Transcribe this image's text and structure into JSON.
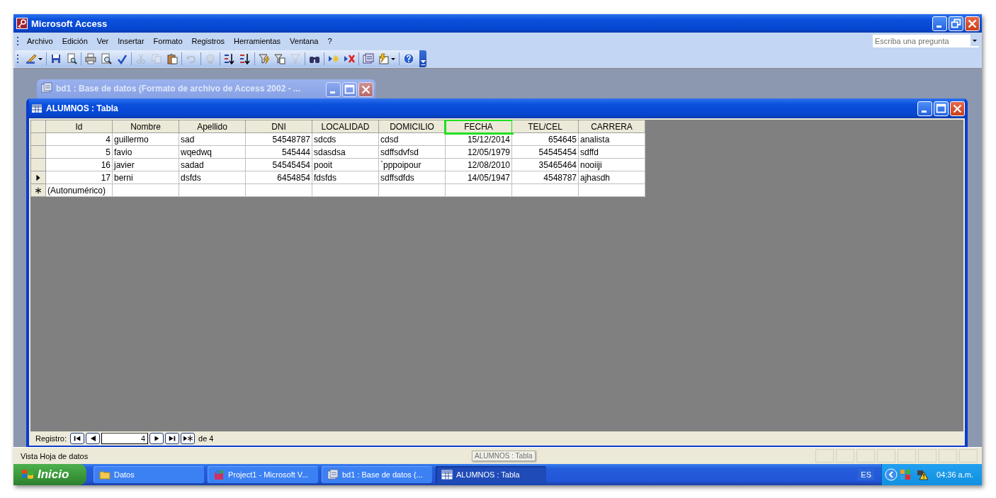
{
  "window": {
    "title": "Microsoft Access"
  },
  "menu": [
    "Archivo",
    "Edición",
    "Ver",
    "Insertar",
    "Formato",
    "Registros",
    "Herramientas",
    "Ventana",
    "?"
  ],
  "question_box": {
    "placeholder": "Escriba una pregunta"
  },
  "toolbar": [
    [
      {
        "kind": "design",
        "disabled": false,
        "dropdown": true
      }
    ],
    [
      {
        "kind": "save",
        "disabled": false
      },
      {
        "kind": "file-search",
        "disabled": false
      }
    ],
    [
      {
        "kind": "print",
        "disabled": false
      },
      {
        "kind": "preview",
        "disabled": false
      },
      {
        "kind": "spell",
        "disabled": false
      }
    ],
    [
      {
        "kind": "cut",
        "disabled": true
      },
      {
        "kind": "copy",
        "disabled": true
      },
      {
        "kind": "paste",
        "disabled": false
      }
    ],
    [
      {
        "kind": "undo",
        "disabled": true
      }
    ],
    [
      {
        "kind": "link",
        "disabled": true
      }
    ],
    [
      {
        "kind": "sort-asc",
        "disabled": false
      },
      {
        "kind": "sort-desc",
        "disabled": false
      }
    ],
    [
      {
        "kind": "filter-selection",
        "disabled": false
      },
      {
        "kind": "filter-form",
        "disabled": false
      },
      {
        "kind": "filter",
        "disabled": true
      }
    ],
    [
      {
        "kind": "find",
        "disabled": false
      }
    ],
    [
      {
        "kind": "new-record",
        "disabled": false
      },
      {
        "kind": "delete-record",
        "disabled": false
      }
    ],
    [
      {
        "kind": "database-window",
        "disabled": false
      },
      {
        "kind": "new-object",
        "disabled": false,
        "dropdown": true
      }
    ],
    [
      {
        "kind": "help",
        "disabled": false
      }
    ]
  ],
  "database_window": {
    "title": "bd1 : Base de datos (Formato de archivo de Access 2002 - ..."
  },
  "table_window": {
    "title": "ALUMNOS : Tabla",
    "columns": [
      {
        "label": "Id",
        "numeric": true,
        "highlighted": false
      },
      {
        "label": "Nombre",
        "numeric": false,
        "highlighted": false
      },
      {
        "label": "Apellido",
        "numeric": false,
        "highlighted": false
      },
      {
        "label": "DNI",
        "numeric": true,
        "highlighted": false
      },
      {
        "label": "LOCALIDAD",
        "numeric": false,
        "highlighted": false
      },
      {
        "label": "DOMICILIO",
        "numeric": false,
        "highlighted": false
      },
      {
        "label": "FECHA",
        "numeric": true,
        "highlighted": true
      },
      {
        "label": "TEL/CEL",
        "numeric": true,
        "highlighted": false
      },
      {
        "label": "CARRERA",
        "numeric": false,
        "highlighted": false
      }
    ],
    "rows": [
      {
        "current": false,
        "cells": [
          "4",
          "guillermo",
          "sad",
          "54548787",
          "sdcds",
          "cdsd",
          "15/12/2014",
          "654645",
          "analista"
        ]
      },
      {
        "current": false,
        "cells": [
          "5",
          "favio",
          "wqedwq",
          "545444",
          "sdasdsa",
          "sdffsdvfsd",
          "12/05/1979",
          "54545454",
          "sdffd"
        ]
      },
      {
        "current": false,
        "cells": [
          "16",
          "javier",
          "sadad",
          "54545454",
          "pooit",
          "`pppoipour",
          "12/08/2010",
          "35465464",
          "nooiiji"
        ]
      },
      {
        "current": true,
        "cells": [
          "17",
          "berni",
          "dsfds",
          "6454854",
          "fdsfds",
          "sdffsdfds",
          "14/05/1947",
          "4548787",
          "ajhasdh"
        ]
      }
    ],
    "new_row": {
      "id_text": "(Autonumérico)"
    },
    "navigation": {
      "label": "Registro:",
      "record": "4",
      "total": "de 4"
    }
  },
  "status_bar": {
    "text": "Vista Hoja de datos"
  },
  "tooltip": {
    "text": "ALUMNOS : Tabla"
  },
  "taskbar": {
    "start": "Inicio",
    "tasks": [
      {
        "kind": "folder",
        "label": "Datos",
        "selected": false
      },
      {
        "kind": "vb",
        "label": "Project1 - Microsoft V...",
        "selected": false
      },
      {
        "kind": "database",
        "label": "bd1 : Base de datos (...",
        "selected": false
      },
      {
        "kind": "table",
        "label": "ALUMNOS : Tabla",
        "selected": true
      }
    ],
    "language": "ES",
    "clock": "04:36 a.m."
  }
}
